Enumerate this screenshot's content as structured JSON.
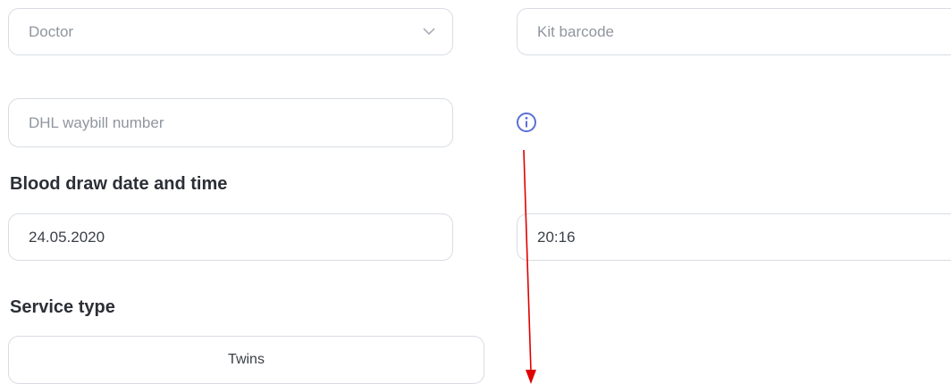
{
  "form": {
    "doctor": {
      "placeholder": "Doctor"
    },
    "kit_barcode": {
      "placeholder": "Kit barcode"
    },
    "dhl_waybill": {
      "placeholder": "DHL waybill number"
    },
    "blood_draw": {
      "heading": "Blood draw date and time",
      "date": "24.05.2020",
      "time": "20:16"
    },
    "service_type": {
      "heading": "Service type",
      "option": "Twins"
    }
  },
  "icons": {
    "info": "info-icon",
    "chevron": "chevron-down-icon",
    "annotation": "arrow-down-icon"
  },
  "colors": {
    "info_icon": "#5b6fd6",
    "annotation_arrow": "#e00000",
    "border": "#d8dde3"
  }
}
